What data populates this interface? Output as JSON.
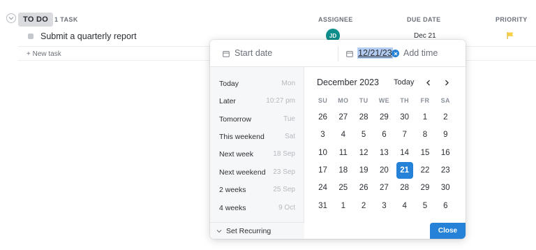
{
  "list": {
    "status": "TO DO",
    "task_count": "1 TASK",
    "columns": {
      "assignee": "ASSIGNEE",
      "due_date": "DUE DATE",
      "priority": "PRIORITY"
    },
    "task": {
      "name": "Submit a quarterly report",
      "assignee_initials": "JD",
      "due": "Dec 21",
      "priority_color": "#f7d046"
    },
    "new_task_label": "+ New task"
  },
  "picker": {
    "start_placeholder": "Start date",
    "end_value": "12/21/23",
    "add_time_label": "Add time",
    "quick": [
      {
        "label": "Today",
        "hint": "Mon"
      },
      {
        "label": "Later",
        "hint": "10:27 pm"
      },
      {
        "label": "Tomorrow",
        "hint": "Tue"
      },
      {
        "label": "This weekend",
        "hint": "Sat"
      },
      {
        "label": "Next week",
        "hint": "18 Sep"
      },
      {
        "label": "Next weekend",
        "hint": "23 Sep"
      },
      {
        "label": "2 weeks",
        "hint": "25 Sep"
      },
      {
        "label": "4 weeks",
        "hint": "9 Oct"
      }
    ],
    "recurring_label": "Set Recurring",
    "month_title": "December 2023",
    "today_label": "Today",
    "weekdays": [
      "SU",
      "MO",
      "TU",
      "WE",
      "TH",
      "FR",
      "SA"
    ],
    "weeks": [
      [
        "26",
        "27",
        "28",
        "29",
        "30",
        "1",
        "2"
      ],
      [
        "3",
        "4",
        "5",
        "6",
        "7",
        "8",
        "9"
      ],
      [
        "10",
        "11",
        "12",
        "13",
        "14",
        "15",
        "16"
      ],
      [
        "17",
        "18",
        "19",
        "20",
        "21",
        "22",
        "23"
      ],
      [
        "24",
        "25",
        "26",
        "27",
        "28",
        "29",
        "30"
      ],
      [
        "31",
        "1",
        "2",
        "3",
        "4",
        "5",
        "6"
      ]
    ],
    "selected": "21",
    "close_label": "Close",
    "accent": "#2582d6"
  }
}
